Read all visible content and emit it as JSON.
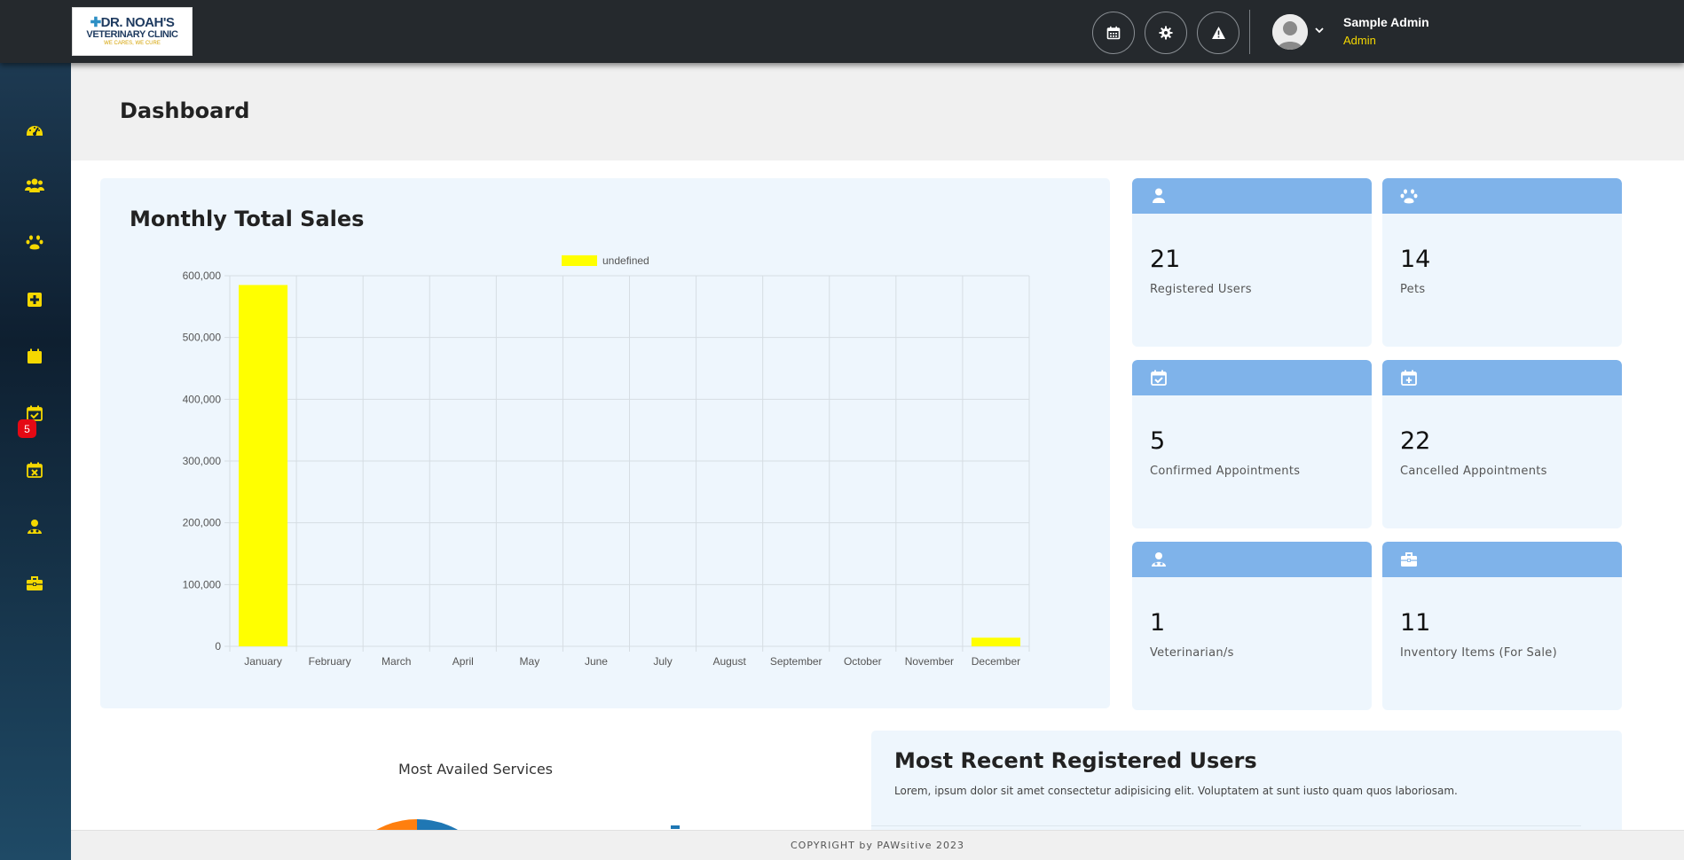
{
  "logo": {
    "line1": "DR. NOAH'S",
    "line2": "VETERINARY CLINIC",
    "line3": "WE CARES, WE CURE"
  },
  "topbar": {
    "buttons": [
      {
        "icon": "calendar-icon"
      },
      {
        "icon": "gear-icon"
      },
      {
        "icon": "warning-icon"
      }
    ],
    "user": {
      "name": "Sample Admin",
      "role": "Admin"
    }
  },
  "sidebar": {
    "items": [
      {
        "icon": "dashboard-gauge-icon"
      },
      {
        "icon": "users-icon"
      },
      {
        "icon": "paw-icon"
      },
      {
        "icon": "medical-plus-icon"
      },
      {
        "icon": "appointments-icon",
        "badge": "5"
      },
      {
        "icon": "calendar-check-icon"
      },
      {
        "icon": "calendar-x-icon"
      },
      {
        "icon": "veterinarian-icon"
      },
      {
        "icon": "briefcase-icon"
      }
    ],
    "accent": "#f5d800",
    "badge_color": "#e50914"
  },
  "page": {
    "title": "Dashboard"
  },
  "sales_chart": {
    "title": "Monthly Total Sales"
  },
  "chart_data": {
    "type": "bar",
    "categories": [
      "January",
      "February",
      "March",
      "April",
      "May",
      "June",
      "July",
      "August",
      "September",
      "October",
      "November",
      "December"
    ],
    "series": [
      {
        "name": "undefined",
        "color": "#ffff00",
        "values": [
          585000,
          0,
          0,
          0,
          0,
          0,
          0,
          0,
          0,
          0,
          0,
          14000
        ]
      }
    ],
    "y_ticks": [
      "0",
      "100,000",
      "200,000",
      "300,000",
      "400,000",
      "500,000",
      "600,000"
    ],
    "ylim": [
      0,
      600000
    ],
    "grid": true,
    "legend": "top-center"
  },
  "stats": [
    {
      "icon": "user-icon",
      "value": "21",
      "label": "Registered Users"
    },
    {
      "icon": "paw-icon",
      "value": "14",
      "label": "Pets"
    },
    {
      "icon": "calendar-check-icon",
      "value": "5",
      "label": "Confirmed Appointments"
    },
    {
      "icon": "calendar-plus-icon",
      "value": "22",
      "label": "Cancelled Appointments"
    },
    {
      "icon": "veterinarian-icon",
      "value": "1",
      "label": "Veterinarian/s"
    },
    {
      "icon": "briefcase-icon",
      "value": "11",
      "label": "Inventory Items (For Sale)"
    }
  ],
  "services": {
    "title": "Most Availed Services"
  },
  "recent_users": {
    "title": "Most Recent Registered Users",
    "subtitle": "Lorem, ipsum dolor sit amet consectetur adipisicing elit. Voluptatem at sunt iusto quam quos laboriosam."
  },
  "footer": {
    "text": "COPYRIGHT by PAWsitive 2023"
  },
  "colors": {
    "topbar": "#25292d",
    "card_bg": "#eef6fd",
    "card_header": "#7fb3ea",
    "bar": "#ffff00"
  }
}
